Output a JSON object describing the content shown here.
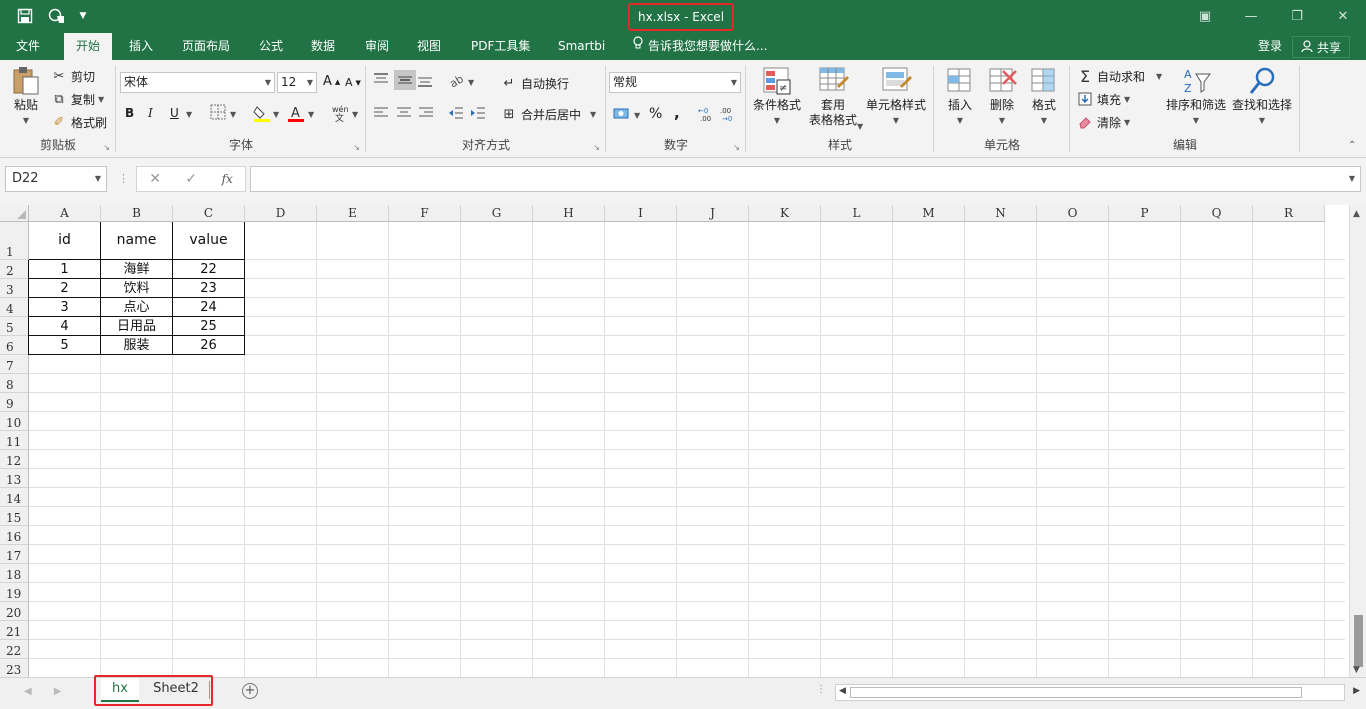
{
  "window": {
    "title": "hx.xlsx - Excel",
    "qat_icons": [
      "save-icon",
      "touch-mode-icon",
      "customize-qat-icon"
    ],
    "controls": [
      "ribbon-display-icon",
      "minimize-icon",
      "restore-icon",
      "close-icon"
    ]
  },
  "tabs": [
    "文件",
    "开始",
    "插入",
    "页面布局",
    "公式",
    "数据",
    "审阅",
    "视图",
    "PDF工具集",
    "Smartbi"
  ],
  "active_tab": "开始",
  "tell_me": "告诉我您想要做什么...",
  "login": "登录",
  "share": "共享",
  "ribbon": {
    "clipboard": {
      "label": "剪贴板",
      "paste": "粘贴",
      "cut": "剪切",
      "copy": "复制",
      "format_painter": "格式刷"
    },
    "font": {
      "label": "字体",
      "name": "宋体",
      "size": "12",
      "bold": "B",
      "italic": "I",
      "underline": "U"
    },
    "alignment": {
      "label": "对齐方式",
      "wrap": "自动换行",
      "merge": "合并后居中"
    },
    "number": {
      "label": "数字",
      "format": "常规",
      "percent": "%",
      "comma": ","
    },
    "styles": {
      "label": "样式",
      "conditional": "条件格式",
      "table_line1": "套用",
      "table_line2": "表格格式",
      "cell_styles": "单元格样式"
    },
    "cells": {
      "label": "单元格",
      "insert": "插入",
      "delete": "删除",
      "format": "格式"
    },
    "editing": {
      "label": "编辑",
      "autosum": "自动求和",
      "fill": "填充",
      "clear": "清除",
      "sort_filter": "排序和筛选",
      "find_select": "查找和选择"
    }
  },
  "formula_bar": {
    "name_box": "D22",
    "formula": "",
    "fx": "fx"
  },
  "sheet": {
    "columns": [
      "A",
      "B",
      "C",
      "D",
      "E",
      "F",
      "G",
      "H",
      "I",
      "J",
      "K",
      "L",
      "M",
      "N",
      "O",
      "P",
      "Q",
      "R"
    ],
    "rows": [
      "1",
      "2",
      "3",
      "4",
      "5",
      "6",
      "7",
      "8",
      "9",
      "10",
      "11",
      "12",
      "13",
      "14",
      "15",
      "16",
      "17",
      "18",
      "19",
      "20",
      "21",
      "22",
      "23"
    ],
    "table": {
      "headers": [
        "id",
        "name",
        "value"
      ],
      "rows": [
        [
          "1",
          "海鲜",
          "22"
        ],
        [
          "2",
          "饮料",
          "23"
        ],
        [
          "3",
          "点心",
          "24"
        ],
        [
          "4",
          "日用品",
          "25"
        ],
        [
          "5",
          "服装",
          "26"
        ]
      ]
    }
  },
  "sheet_tabs": [
    "hx",
    "Sheet2"
  ],
  "active_sheet": "hx",
  "colors": {
    "excel_green": "#217346",
    "highlight_red": "#e8262b",
    "fill_yellow": "#ffff00",
    "font_red": "#ff0000"
  }
}
